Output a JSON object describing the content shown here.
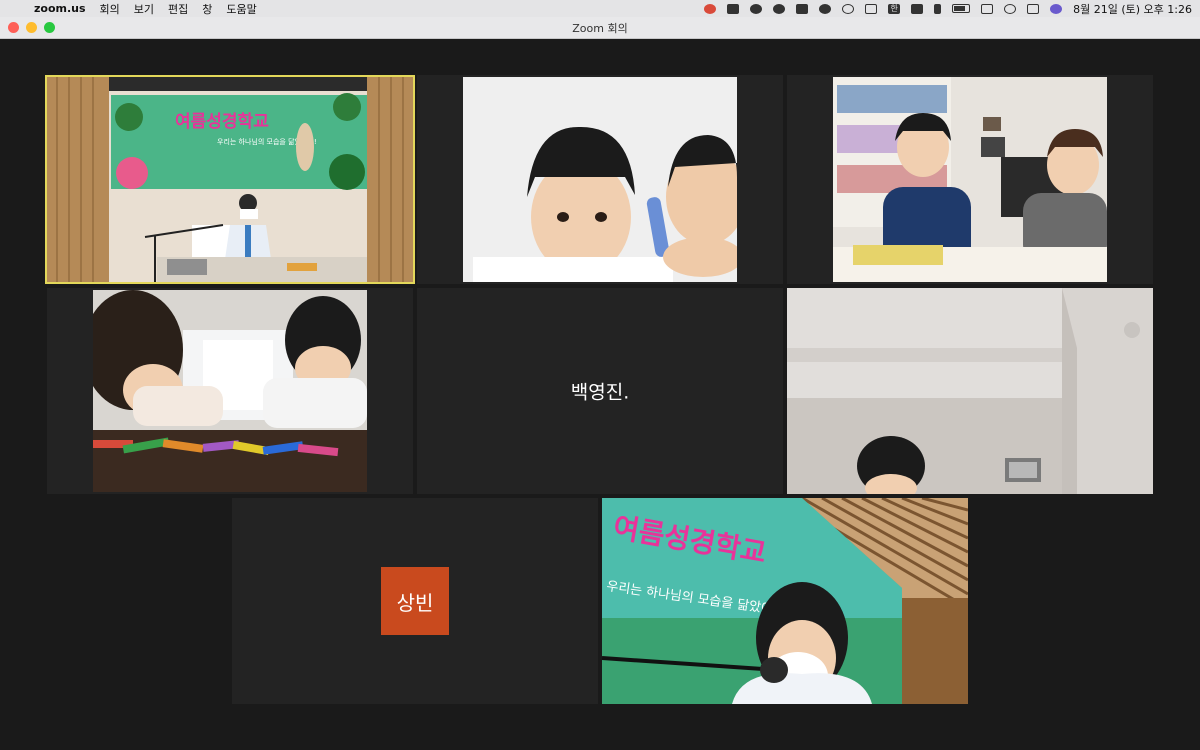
{
  "menubar": {
    "app_name": "zoom.us",
    "menus": [
      "회의",
      "보기",
      "편집",
      "창",
      "도움말"
    ],
    "status_icons": [
      "control-center-icon",
      "zoom-icon",
      "cloud-icon",
      "cloud-icon",
      "grid-icon",
      "contrast-icon",
      "play-icon",
      "window-icon",
      "korean-input-icon",
      "volume-icon",
      "bluetooth-icon",
      "battery-icon",
      "airplay-icon",
      "search-icon",
      "toggle-icon",
      "siri-icon"
    ],
    "input_label": "한",
    "clock": "8월 21일 (토) 오후 1:26"
  },
  "window": {
    "title": "Zoom 회의"
  },
  "participants": [
    {
      "id": "p1",
      "kind": "video",
      "active": true,
      "desc": "teacher at summer bible school stage"
    },
    {
      "id": "p2",
      "kind": "video",
      "active": false
    },
    {
      "id": "p3",
      "kind": "video",
      "active": false
    },
    {
      "id": "p4",
      "kind": "video",
      "active": false
    },
    {
      "id": "p5",
      "kind": "name",
      "name": "백영진."
    },
    {
      "id": "p6",
      "kind": "video",
      "active": false
    },
    {
      "id": "p7",
      "kind": "avatar",
      "name": "상빈"
    },
    {
      "id": "p8",
      "kind": "video",
      "active": false
    }
  ],
  "banner": {
    "main": "여름성경학교",
    "sub": "우리는 하나님의 모습을 닮았어요!"
  },
  "colors": {
    "active_border": "#e3d85a",
    "avatar_bg": "#c94a1e",
    "tile_bg": "#232323",
    "stage_bg": "#1a1a1a"
  }
}
